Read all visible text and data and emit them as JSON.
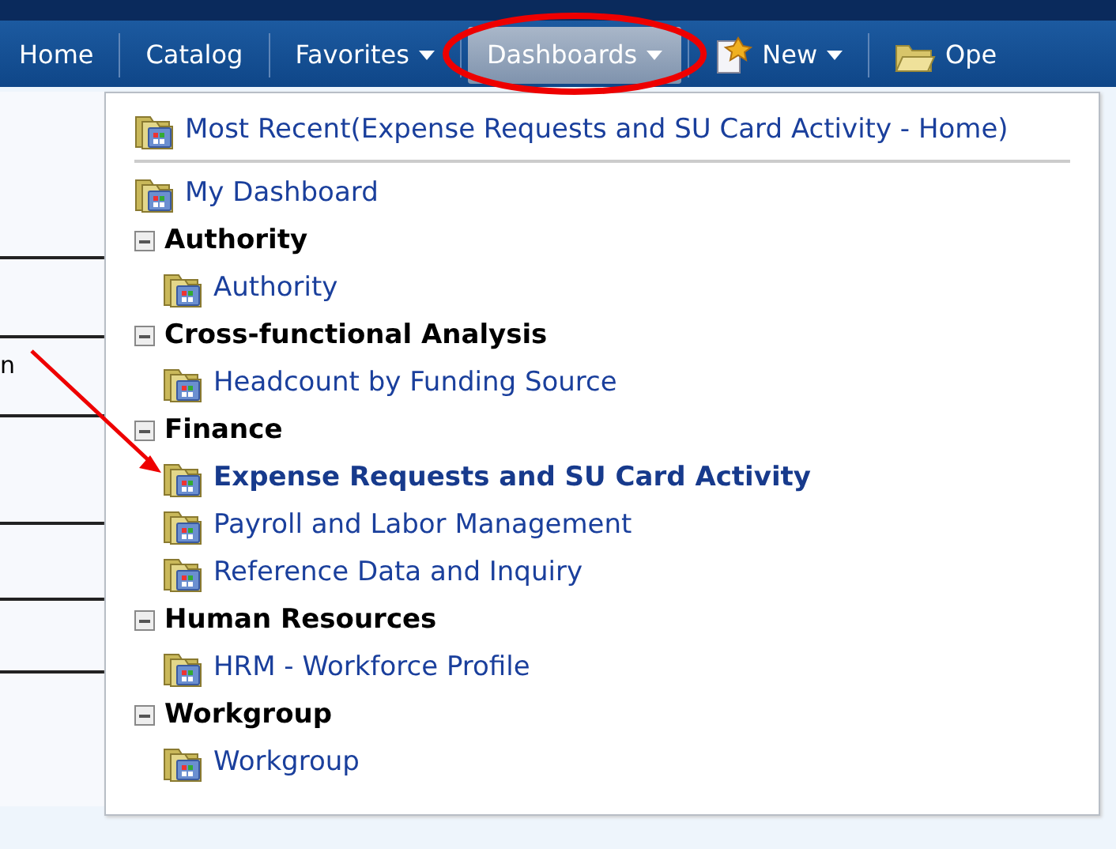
{
  "navbar": {
    "items": [
      {
        "label": "Home",
        "kind": "plain",
        "selected": false
      },
      {
        "label": "Catalog",
        "kind": "plain",
        "selected": false
      },
      {
        "label": "Favorites",
        "kind": "dropdown",
        "selected": false
      },
      {
        "label": "Dashboards",
        "kind": "dropdown",
        "selected": true
      },
      {
        "label": "New",
        "kind": "new",
        "selected": false
      },
      {
        "label": "Ope",
        "kind": "open",
        "selected": false
      }
    ]
  },
  "background": {
    "cut_text": "n"
  },
  "menu": {
    "recent": "Most Recent(Expense Requests and SU Card Activity - Home)",
    "my_dashboard": "My Dashboard",
    "groups": [
      {
        "label": "Authority",
        "expanded": true,
        "children": [
          {
            "label": "Authority",
            "selected": false
          }
        ]
      },
      {
        "label": "Cross-functional Analysis",
        "expanded": true,
        "children": [
          {
            "label": "Headcount by Funding Source",
            "selected": false
          }
        ]
      },
      {
        "label": "Finance",
        "expanded": true,
        "children": [
          {
            "label": "Expense Requests and SU Card Activity",
            "selected": true
          },
          {
            "label": "Payroll and Labor Management",
            "selected": false
          },
          {
            "label": "Reference Data and Inquiry",
            "selected": false
          }
        ]
      },
      {
        "label": "Human Resources",
        "expanded": true,
        "children": [
          {
            "label": "HRM - Workforce Profile",
            "selected": false
          }
        ]
      },
      {
        "label": "Workgroup",
        "expanded": true,
        "children": [
          {
            "label": "Workgroup",
            "selected": false
          }
        ]
      }
    ]
  }
}
